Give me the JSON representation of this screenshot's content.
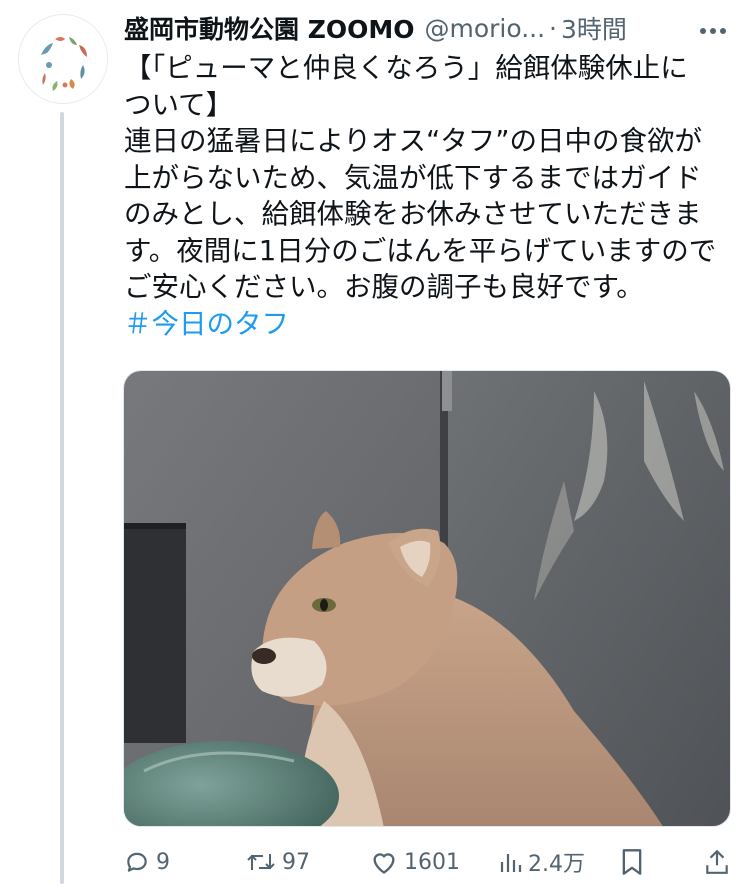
{
  "tweet": {
    "display_name": "盛岡市動物公園 ZOOMO",
    "handle": "@morio...",
    "separator": "·",
    "time": "3時間",
    "more_icon": "more-dots-icon",
    "text_lines": [
      "【「ピューマと仲良くなろう」給餌体験休止に",
      "ついて】",
      "連日の猛暑日によりオス“タフ”の日中の食欲が",
      "上がらないため、気温が低下するまではガイド",
      "のみとし、給餌体験をお休みさせていただきま",
      "す。夜間に1日分のごはんを平らげていますので",
      "ご安心ください。お腹の調子も良好です。"
    ],
    "hashtag": "＃今日のタフ"
  },
  "actions": {
    "reply_count": "9",
    "retweet_count": "97",
    "like_count": "1601",
    "views_count": "2.4万",
    "icons": [
      "reply-icon",
      "retweet-icon",
      "like-icon",
      "views-icon",
      "bookmark-icon",
      "share-icon"
    ]
  },
  "colors": {
    "text": "#0f1419",
    "secondary": "#536471",
    "link": "#1d9bf0",
    "thread_line": "#cfd9de"
  }
}
